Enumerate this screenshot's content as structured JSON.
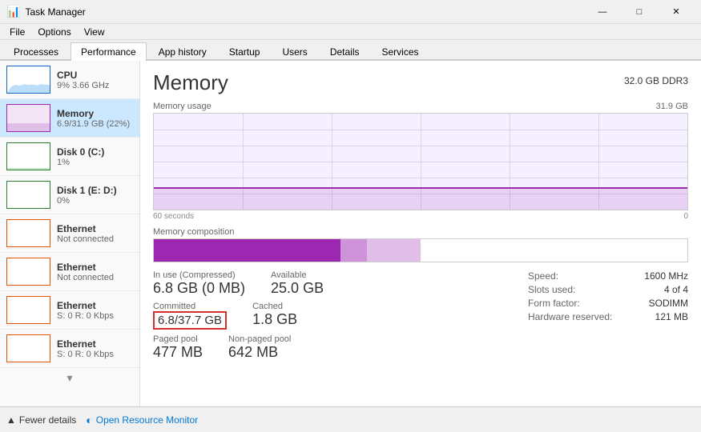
{
  "window": {
    "title": "Task Manager",
    "icon": "📊"
  },
  "menu": {
    "items": [
      "File",
      "Options",
      "View"
    ]
  },
  "tabs": [
    "Processes",
    "Performance",
    "App history",
    "Startup",
    "Users",
    "Details",
    "Services"
  ],
  "active_tab": "Performance",
  "sidebar": {
    "items": [
      {
        "id": "cpu",
        "name": "CPU",
        "value": "9% 3.66 GHz",
        "graph_type": "cpu"
      },
      {
        "id": "memory",
        "name": "Memory",
        "value": "6.9/31.9 GB (22%)",
        "graph_type": "memory",
        "active": true
      },
      {
        "id": "disk0",
        "name": "Disk 0 (C:)",
        "value": "1%",
        "graph_type": "disk0"
      },
      {
        "id": "disk1",
        "name": "Disk 1 (E: D:)",
        "value": "0%",
        "graph_type": "disk1"
      },
      {
        "id": "eth1",
        "name": "Ethernet",
        "value": "Not connected",
        "graph_type": "ethernet"
      },
      {
        "id": "eth2",
        "name": "Ethernet",
        "value": "Not connected",
        "graph_type": "ethernet"
      },
      {
        "id": "eth3",
        "name": "Ethernet",
        "value": "S: 0 R: 0 Kbps",
        "graph_type": "ethernet"
      },
      {
        "id": "eth4",
        "name": "Ethernet",
        "value": "S: 0 R: 0 Kbps",
        "graph_type": "ethernet"
      }
    ]
  },
  "panel": {
    "title": "Memory",
    "subtitle": "32.0 GB DDR3",
    "chart": {
      "label": "Memory usage",
      "max_label": "31.9 GB",
      "time_start": "60 seconds",
      "time_end": "0"
    },
    "composition_label": "Memory composition",
    "stats": {
      "in_use_label": "In use (Compressed)",
      "in_use_value": "6.8 GB (0 MB)",
      "available_label": "Available",
      "available_value": "25.0 GB",
      "committed_label": "Committed",
      "committed_value": "6.8/37.7 GB",
      "cached_label": "Cached",
      "cached_value": "1.8 GB",
      "paged_pool_label": "Paged pool",
      "paged_pool_value": "477 MB",
      "non_paged_pool_label": "Non-paged pool",
      "non_paged_pool_value": "642 MB"
    },
    "right_stats": {
      "speed_label": "Speed:",
      "speed_value": "1600 MHz",
      "slots_label": "Slots used:",
      "slots_value": "4 of 4",
      "form_label": "Form factor:",
      "form_value": "SODIMM",
      "hw_reserved_label": "Hardware reserved:",
      "hw_reserved_value": "121 MB"
    }
  },
  "bottom": {
    "fewer_details": "Fewer details",
    "resource_monitor": "Open Resource Monitor"
  }
}
